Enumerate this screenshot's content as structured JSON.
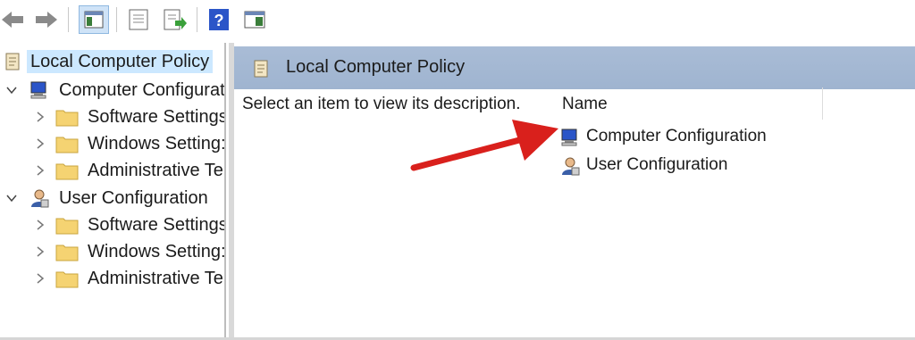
{
  "toolbar": {
    "buttons": [
      {
        "name": "back",
        "icon": "back-arrow-icon"
      },
      {
        "name": "forward",
        "icon": "forward-arrow-icon"
      },
      {
        "name": "show-hide-console-tree",
        "icon": "console-tree-icon"
      },
      {
        "name": "properties",
        "icon": "properties-icon"
      },
      {
        "name": "export-list",
        "icon": "export-list-icon"
      },
      {
        "name": "help",
        "icon": "help-icon"
      },
      {
        "name": "show-hide-action-pane",
        "icon": "action-pane-icon"
      }
    ]
  },
  "tree": {
    "root": {
      "label": "Local Computer Policy",
      "icon": "policy-scroll-icon"
    },
    "computer": {
      "label": "Computer Configurat",
      "icon": "computer-config-icon",
      "children": [
        {
          "label": "Software Settings"
        },
        {
          "label": "Windows Setting:"
        },
        {
          "label": "Administrative Te"
        }
      ]
    },
    "user": {
      "label": "User Configuration",
      "icon": "user-config-icon",
      "children": [
        {
          "label": "Software Settings"
        },
        {
          "label": "Windows Setting:"
        },
        {
          "label": "Administrative Te"
        }
      ]
    }
  },
  "right": {
    "header_title": "Local Computer Policy",
    "description": "Select an item to view its description.",
    "column_name": "Name",
    "items": [
      {
        "label": "Computer Configuration",
        "icon": "computer-config-icon"
      },
      {
        "label": "User Configuration",
        "icon": "user-config-icon"
      }
    ]
  },
  "colors": {
    "header_bg": "#a9bcd6",
    "selection": "#cce8ff",
    "arrow": "#d9201c",
    "folder": "#f5d372"
  }
}
